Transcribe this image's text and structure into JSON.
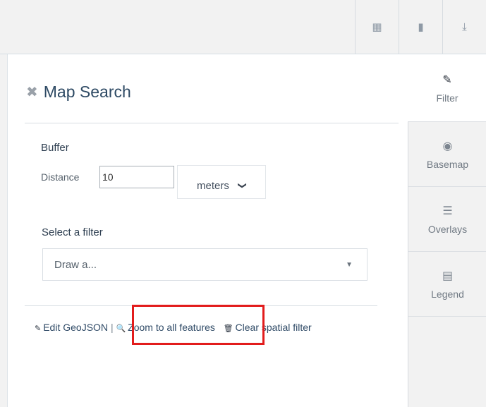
{
  "toolbar": {
    "buttons": [
      {
        "icon": "calendar-icon",
        "glyph": "▦"
      },
      {
        "icon": "bookmark-icon",
        "glyph": "▮"
      },
      {
        "icon": "download-icon",
        "glyph": "⤓"
      }
    ]
  },
  "panel": {
    "close_glyph": "✖",
    "title": "Map Search",
    "buffer": {
      "label": "Buffer",
      "distance_label": "Distance",
      "distance_value": "10",
      "unit": "meters",
      "unit_chevron": "❯"
    },
    "filter": {
      "label": "Select a filter",
      "selected": "Draw a...",
      "caret": "▼"
    },
    "actions": {
      "edit_icon": "✎",
      "edit_label": "Edit GeoJSON",
      "separator": "|",
      "zoom_icon": "🔍",
      "zoom_label": "Zoom to all features",
      "clear_icon": "🗑",
      "clear_label": "Clear spatial filter"
    }
  },
  "sidebar": {
    "tabs": [
      {
        "label": "Filter",
        "icon": "pencil-icon",
        "glyph": "✎",
        "active": true
      },
      {
        "label": "Basemap",
        "icon": "globe-icon",
        "glyph": "◉",
        "active": false
      },
      {
        "label": "Overlays",
        "icon": "list-icon",
        "glyph": "☰",
        "active": false
      },
      {
        "label": "Legend",
        "icon": "legend-icon",
        "glyph": "▤",
        "active": false
      }
    ]
  },
  "colors": {
    "accent_text": "#2e4a64",
    "highlight": "#e21c1c",
    "sidebar_bg": "#f2f2f2"
  }
}
